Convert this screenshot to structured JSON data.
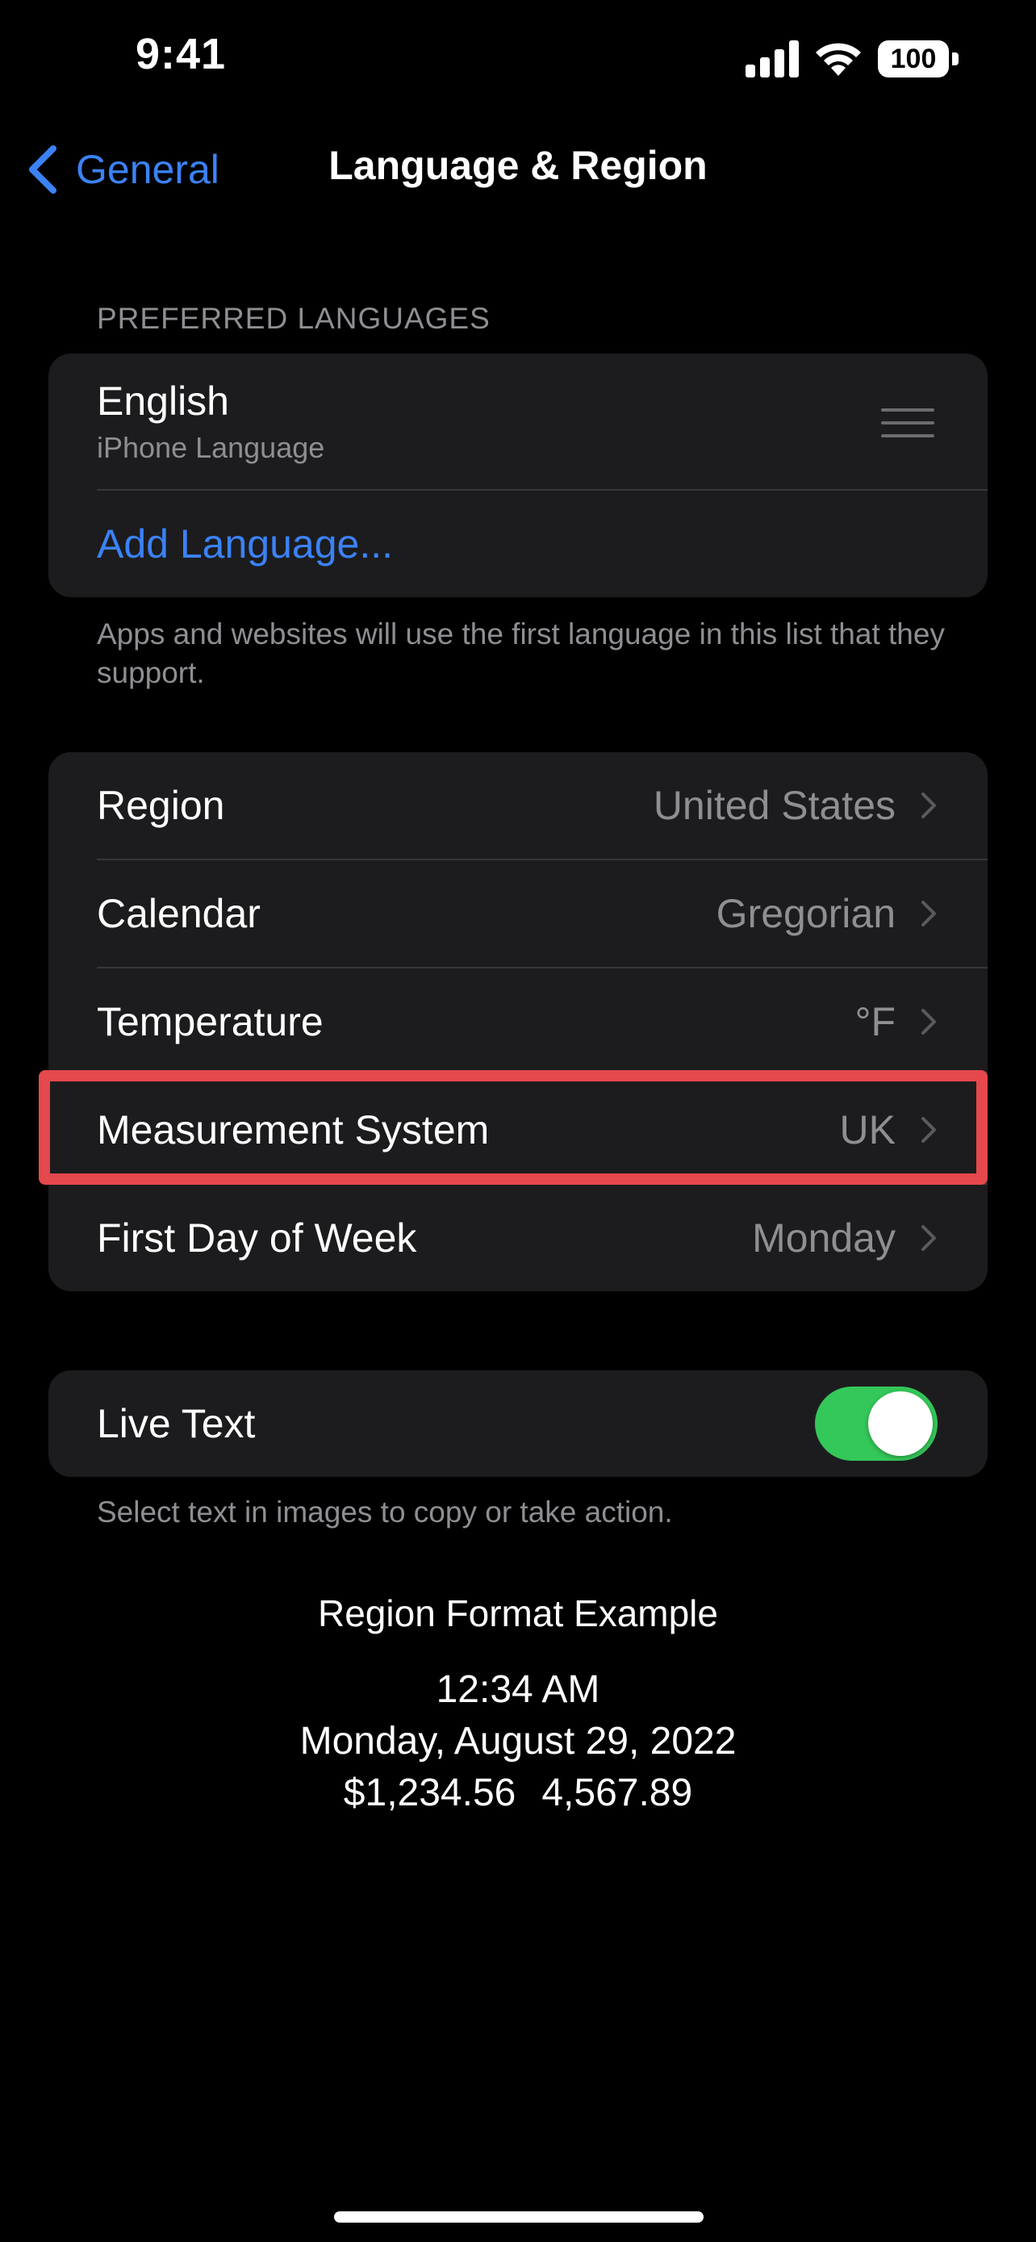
{
  "status_bar": {
    "time": "9:41",
    "battery_level": "100"
  },
  "nav": {
    "back_label": "General",
    "title": "Language & Region"
  },
  "preferred_languages": {
    "header": "PREFERRED LANGUAGES",
    "language": {
      "name": "English",
      "subtitle": "iPhone Language"
    },
    "add_label": "Add Language...",
    "footnote": "Apps and websites will use the first language in this list that they support."
  },
  "region_settings": [
    {
      "label": "Region",
      "value": "United States"
    },
    {
      "label": "Calendar",
      "value": "Gregorian"
    },
    {
      "label": "Temperature",
      "value": "°F"
    },
    {
      "label": "Measurement System",
      "value": "UK",
      "highlighted": true
    },
    {
      "label": "First Day of Week",
      "value": "Monday"
    }
  ],
  "live_text": {
    "label": "Live Text",
    "enabled": true,
    "footnote": "Select text in images to copy or take action."
  },
  "region_format_example": {
    "title": "Region Format Example",
    "time": "12:34 AM",
    "date": "Monday, August 29, 2022",
    "currency": "$1,234.56",
    "number": "4,567.89"
  },
  "colors": {
    "accent": "#3b82f6",
    "toggle_on": "#34c759",
    "highlight": "#e5484d",
    "card": "#1c1c1e",
    "secondary_text": "#8e8e93"
  }
}
